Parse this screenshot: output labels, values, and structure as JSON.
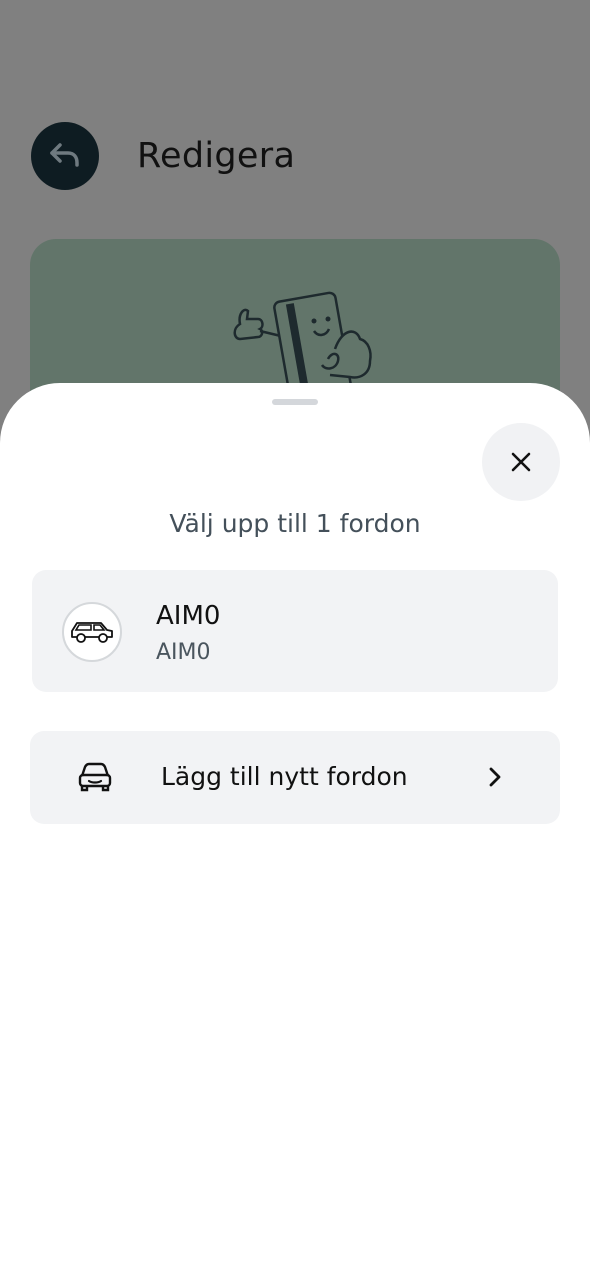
{
  "background_page": {
    "title": "Redigera",
    "back_icon": "back-arrow-icon"
  },
  "sheet": {
    "title": "Välj upp till 1 fordon",
    "close_icon": "close-icon",
    "vehicles": [
      {
        "name": "AIM0",
        "plate": "AIM0",
        "icon": "car-icon"
      }
    ],
    "add_vehicle": {
      "label": "Lägg till nytt fordon",
      "icon": "car-front-icon",
      "chevron_icon": "chevron-right-icon"
    }
  },
  "colors": {
    "scrim": "#808080",
    "back_button": "#0e1c22",
    "hero_card": "#62756a",
    "card_background": "#f2f3f5"
  }
}
